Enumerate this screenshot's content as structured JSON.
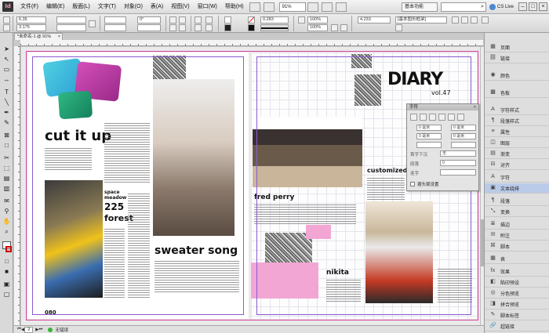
{
  "menubar": {
    "items": [
      "文件(F)",
      "编辑(E)",
      "版面(L)",
      "文字(T)",
      "对象(O)",
      "表(A)",
      "视图(V)",
      "窗口(W)",
      "帮助(H)"
    ],
    "zoom": "91%",
    "workspace": "基本功能",
    "cs_live": "CS Live"
  },
  "control": {
    "x_value": "6.35",
    "y_value": "3.175",
    "stroke_value": "0.283",
    "percent_w": "100%",
    "percent_h": "100%",
    "offset_value": "4.233",
    "style_select": "[基本图形框架]",
    "angle": "0°"
  },
  "document": {
    "tab_title": "*未命名-1 @ 91%",
    "left_folio": "080",
    "headline_cutitup": "cut it up",
    "headline_225": "225",
    "headline_forest": "forest",
    "headline_sweater": "sweater song",
    "headline_diary": "DIARY",
    "headline_diary_vol": "vol.47",
    "headline_fredperry": "fred perry",
    "headline_customized": "customized g",
    "headline_nikita": "nikita",
    "headline_space": "space\nmeadow"
  },
  "float_panel": {
    "title": "字符",
    "labels": [
      "段前",
      "段后",
      "首字下沉",
      "字符样式",
      "拼写检查",
      "段落",
      "连字"
    ],
    "values": [
      "0 毫米",
      "0 毫米",
      "0 毫米",
      "0 毫米",
      "无",
      "0"
    ],
    "checkbox_label": "避头尾设置"
  },
  "panels": {
    "items": [
      "页面",
      "链接",
      "颜色",
      "色板",
      "字符样式",
      "段落样式",
      "属性",
      "图层",
      "渐变",
      "对齐",
      "字符",
      "文本绕排",
      "段落",
      "变换",
      "描边",
      "附注",
      "脚本",
      "表",
      "效果",
      "陷印预设",
      "分色预览",
      "拼合预览",
      "脚本标签",
      "超链接"
    ]
  },
  "status": {
    "page": "2",
    "preflight": "无错误"
  },
  "colors": {
    "bleed": "#d7409a",
    "margin": "#8a5bd0",
    "selected_panel": "#b9cbe8"
  }
}
